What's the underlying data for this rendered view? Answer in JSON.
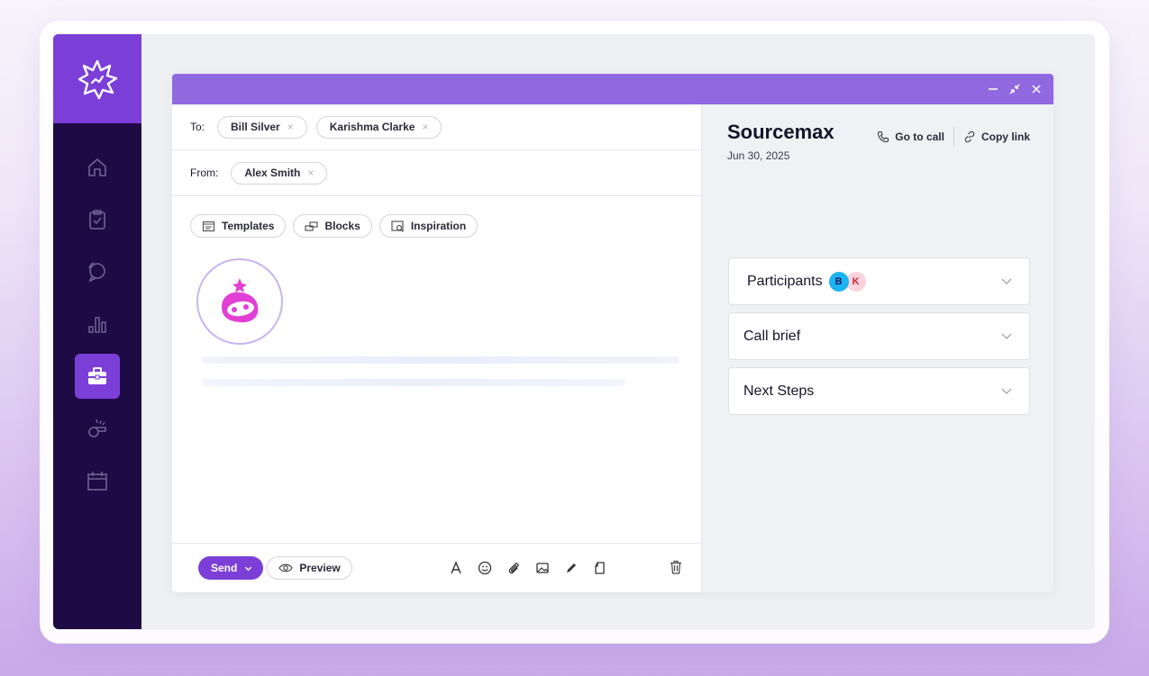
{
  "sidebar": {
    "logo_icon": "starburst-logo-icon",
    "items": [
      {
        "icon": "home-icon"
      },
      {
        "icon": "clipboard-check-icon"
      },
      {
        "icon": "chat-bubbles-icon"
      },
      {
        "icon": "bar-chart-icon"
      },
      {
        "icon": "briefcase-icon",
        "active": true
      },
      {
        "icon": "whistle-icon"
      },
      {
        "icon": "calendar-icon"
      }
    ],
    "colors": {
      "bg": "#1e0a45",
      "accent": "#7b3fd8"
    }
  },
  "window": {
    "titlebar_color": "#9069e0",
    "controls": [
      "minimize-icon",
      "collapse-icon",
      "close-icon"
    ]
  },
  "compose": {
    "to_label": "To:",
    "to_recipients": [
      "Bill Silver",
      "Karishma Clarke"
    ],
    "from_label": "From:",
    "from_sender": "Alex Smith",
    "remove_glyph": "×",
    "tools": [
      "Templates",
      "Blocks",
      "Inspiration"
    ],
    "footer": {
      "send_label": "Send",
      "preview_label": "Preview",
      "format_icons": [
        "text-format-icon",
        "emoji-icon",
        "attachment-icon",
        "image-icon",
        "pen-icon",
        "document-icon"
      ]
    }
  },
  "side_panel": {
    "title": "Sourcemax",
    "date": "Jun 30, 2025",
    "go_to_call": "Go to call",
    "copy_link": "Copy link",
    "sections": [
      {
        "label": "Participants",
        "avatars": [
          {
            "initial": "B",
            "color": "#1bb4f0"
          },
          {
            "initial": "K",
            "color": "#fbd3dc"
          }
        ]
      },
      {
        "label": "Call brief"
      },
      {
        "label": "Next Steps"
      }
    ]
  }
}
